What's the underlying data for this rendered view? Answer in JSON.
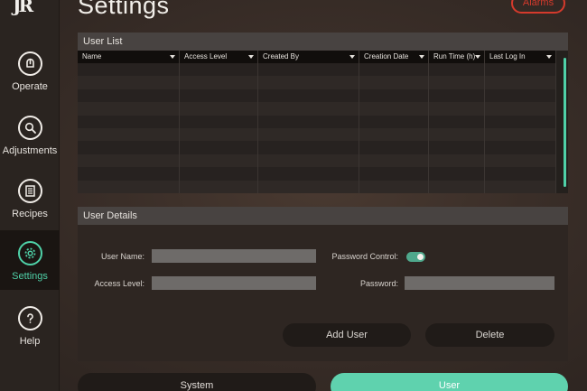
{
  "app": {
    "logo": "JR"
  },
  "header": {
    "title": "Settings",
    "alarms_label": "Alarms"
  },
  "sidebar": {
    "items": [
      {
        "label": "Operate",
        "icon": "operate-icon"
      },
      {
        "label": "Adjustments",
        "icon": "adjustments-icon"
      },
      {
        "label": "Recipes",
        "icon": "recipes-icon"
      },
      {
        "label": "Settings",
        "icon": "gear-icon",
        "active": true
      },
      {
        "label": "Help",
        "icon": "help-icon"
      }
    ]
  },
  "user_list": {
    "title": "User List",
    "columns": [
      "Name",
      "Access Level",
      "Created By",
      "Creation Date",
      "Run Time (h)",
      "Last Log In"
    ],
    "rows": []
  },
  "user_details": {
    "title": "User Details",
    "user_name_label": "User Name:",
    "user_name_value": "",
    "access_level_label": "Access Level:",
    "access_level_value": "",
    "password_control_label": "Password Control:",
    "password_control_on": true,
    "password_label": "Password:",
    "password_value": "",
    "add_user_label": "Add User",
    "delete_label": "Delete"
  },
  "bottom_tabs": {
    "system_label": "System",
    "user_label": "User"
  },
  "colors": {
    "accent": "#4fd1a8",
    "alarm": "#d43a2c",
    "active_tab": "#5fd2ae"
  }
}
